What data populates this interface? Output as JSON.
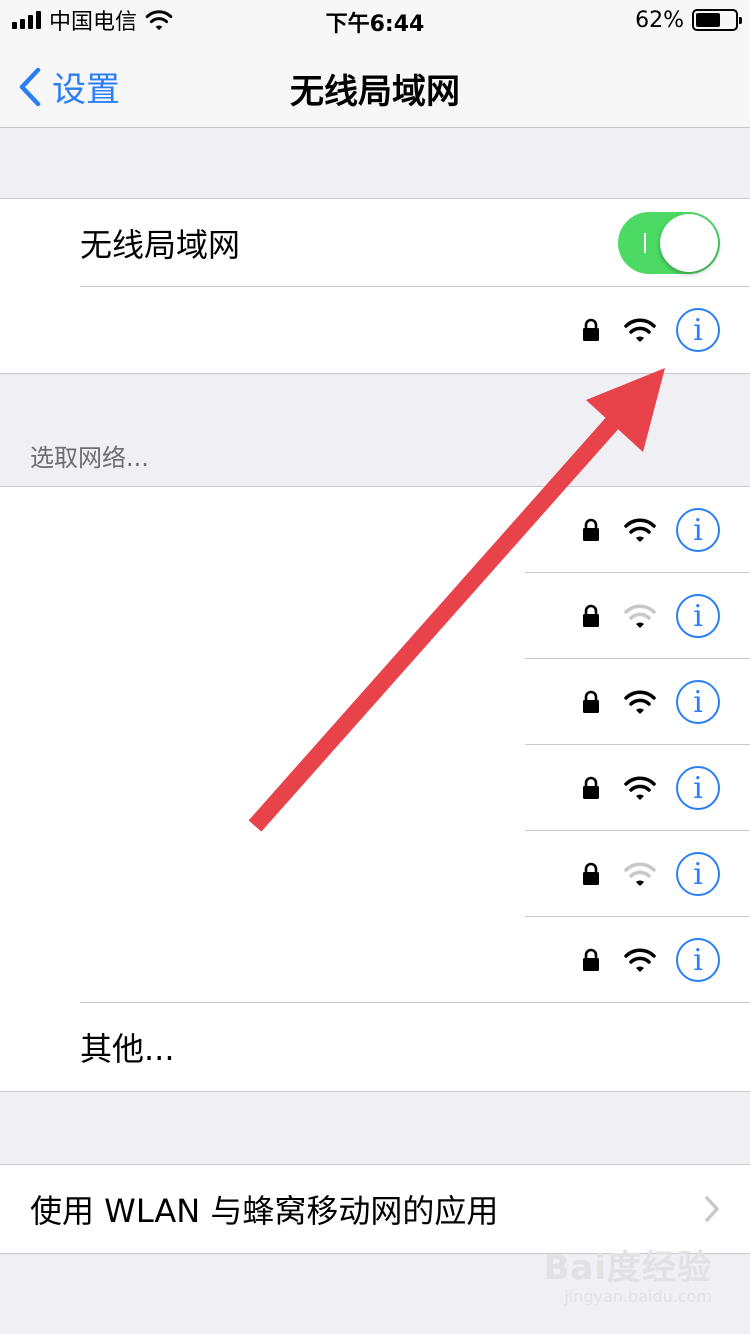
{
  "status_bar": {
    "carrier": "中国电信",
    "time": "下午6:44",
    "battery": "62%",
    "battery_level": 0.62
  },
  "nav": {
    "back_label": "设置",
    "title": "无线局域网"
  },
  "wifi_toggle": {
    "label": "无线局域网",
    "on": true
  },
  "connected_network": {
    "info_glyph": "i",
    "signal": "full"
  },
  "section_header": "选取网络...",
  "networks": [
    {
      "info_glyph": "i",
      "signal": "full"
    },
    {
      "info_glyph": "i",
      "signal": "weak"
    },
    {
      "info_glyph": "i",
      "signal": "full"
    },
    {
      "info_glyph": "i",
      "signal": "full"
    },
    {
      "info_glyph": "i",
      "signal": "weak"
    },
    {
      "info_glyph": "i",
      "signal": "full"
    }
  ],
  "other_label": "其他...",
  "wlan_apps_label": "使用 WLAN 与蜂窝移动网的应用",
  "watermark": {
    "logo": "Bai度经验",
    "url": "jingyan.baidu.com"
  },
  "colors": {
    "accent": "#2a7ef6",
    "toggle_on": "#4cd964",
    "arrow": "#e8424b"
  }
}
